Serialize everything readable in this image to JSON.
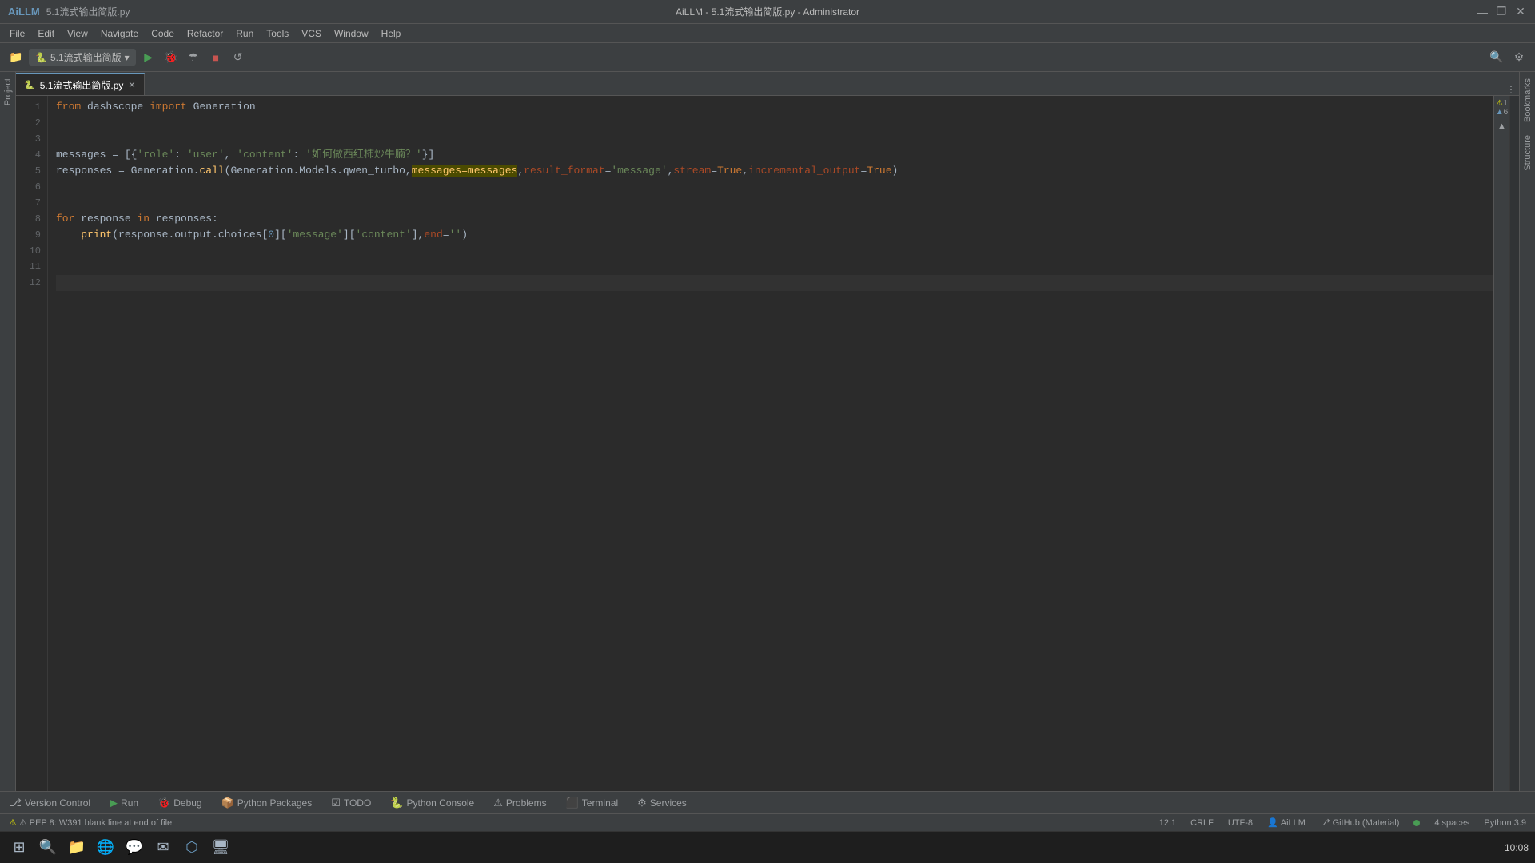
{
  "titleBar": {
    "appName": "AiLLM",
    "filePath": "5.1流式输出简版.py",
    "title": "AiLLM - 5.1流式输出简版.py - Administrator",
    "minimize": "—",
    "restore": "❐",
    "close": "✕"
  },
  "menuBar": {
    "items": [
      "File",
      "Edit",
      "View",
      "Navigate",
      "Code",
      "Refactor",
      "Run",
      "Tools",
      "VCS",
      "Window",
      "Help"
    ]
  },
  "toolbar": {
    "runConfig": "5.1流式输出简版",
    "runConfigDropdown": "▾"
  },
  "tabs": [
    {
      "label": "5.1流式输出简版.py",
      "active": true,
      "icon": "🐍"
    }
  ],
  "codeLines": [
    {
      "num": 1,
      "content": "from dashscope import Generation",
      "tokens": [
        {
          "t": "kw",
          "v": "from"
        },
        {
          "t": "var",
          "v": " dashscope "
        },
        {
          "t": "kw",
          "v": "import"
        },
        {
          "t": "var",
          "v": " Generation"
        }
      ]
    },
    {
      "num": 2,
      "content": "",
      "tokens": []
    },
    {
      "num": 3,
      "content": "",
      "tokens": []
    },
    {
      "num": 4,
      "content": "messages = [{'role': 'user', 'content': '如何做西红柿炒牛腩？'}]",
      "tokens": [
        {
          "t": "var",
          "v": "messages"
        },
        {
          "t": "var",
          "v": " = [{"
        },
        {
          "t": "str",
          "v": "'role'"
        },
        {
          "t": "var",
          "v": ": "
        },
        {
          "t": "str",
          "v": "'user'"
        },
        {
          "t": "var",
          "v": ", "
        },
        {
          "t": "str",
          "v": "'content'"
        },
        {
          "t": "var",
          "v": ": "
        },
        {
          "t": "str",
          "v": "'如何做西红柿炒牛腩？'"
        },
        {
          "t": "var",
          "v": "}]"
        }
      ]
    },
    {
      "num": 5,
      "content": "responses = Generation.call(Generation.Models.qwen_turbo,messages=messages,result_format='message',stream=True,incremental_output=True)",
      "tokens": [
        {
          "t": "var",
          "v": "responses"
        },
        {
          "t": "var",
          "v": " = "
        },
        {
          "t": "var",
          "v": "Generation"
        },
        {
          "t": "dot",
          "v": "."
        },
        {
          "t": "fn",
          "v": "call"
        },
        {
          "t": "var",
          "v": "("
        },
        {
          "t": "var",
          "v": "Generation"
        },
        {
          "t": "dot",
          "v": "."
        },
        {
          "t": "var",
          "v": "Models"
        },
        {
          "t": "dot",
          "v": "."
        },
        {
          "t": "var",
          "v": "qwen_turbo"
        },
        {
          "t": "var",
          "v": ","
        },
        {
          "t": "hl",
          "v": "messages=messages"
        },
        {
          "t": "var",
          "v": ","
        },
        {
          "t": "param-name",
          "v": "result_format"
        },
        {
          "t": "var",
          "v": "="
        },
        {
          "t": "str",
          "v": "'message'"
        },
        {
          "t": "var",
          "v": ","
        },
        {
          "t": "param-name",
          "v": "stream"
        },
        {
          "t": "var",
          "v": "="
        },
        {
          "t": "kw2",
          "v": "True"
        },
        {
          "t": "var",
          "v": ","
        },
        {
          "t": "param-name",
          "v": "incremental_output"
        },
        {
          "t": "var",
          "v": "="
        },
        {
          "t": "kw2",
          "v": "True"
        },
        {
          "t": "var",
          "v": ")"
        }
      ]
    },
    {
      "num": 6,
      "content": "",
      "tokens": []
    },
    {
      "num": 7,
      "content": "",
      "tokens": []
    },
    {
      "num": 8,
      "content": "for response in responses:",
      "tokens": [
        {
          "t": "kw",
          "v": "for"
        },
        {
          "t": "var",
          "v": " response "
        },
        {
          "t": "kw",
          "v": "in"
        },
        {
          "t": "var",
          "v": " responses:"
        }
      ]
    },
    {
      "num": 9,
      "content": "    print(response.output.choices[0]['message']['content'],end='')",
      "tokens": [
        {
          "t": "var",
          "v": "    "
        },
        {
          "t": "fn",
          "v": "print"
        },
        {
          "t": "var",
          "v": "(response"
        },
        {
          "t": "dot",
          "v": "."
        },
        {
          "t": "var",
          "v": "output"
        },
        {
          "t": "dot",
          "v": "."
        },
        {
          "t": "var",
          "v": "choices["
        },
        {
          "t": "num",
          "v": "0"
        },
        {
          "t": "var",
          "v": "]["
        },
        {
          "t": "str",
          "v": "'message'"
        },
        {
          "t": "var",
          "v": "]["
        },
        {
          "t": "str",
          "v": "'content'"
        },
        {
          "t": "var",
          "v": "],"
        },
        {
          "t": "param-name",
          "v": "end"
        },
        {
          "t": "var",
          "v": "="
        },
        {
          "t": "str",
          "v": "''"
        },
        {
          "t": "var",
          "v": ")"
        }
      ]
    },
    {
      "num": 10,
      "content": "",
      "tokens": []
    },
    {
      "num": 11,
      "content": "",
      "tokens": []
    },
    {
      "num": 12,
      "content": "",
      "tokens": [],
      "active": true
    }
  ],
  "bottomTools": [
    {
      "icon": "⎇",
      "label": "Version Control"
    },
    {
      "icon": "▶",
      "label": "Run"
    },
    {
      "icon": "🐞",
      "label": "Debug"
    },
    {
      "icon": "📦",
      "label": "Python Packages"
    },
    {
      "icon": "☑",
      "label": "TODO"
    },
    {
      "icon": "🐍",
      "label": "Python Console"
    },
    {
      "icon": "⚠",
      "label": "Problems"
    },
    {
      "icon": "⬛",
      "label": "Terminal"
    },
    {
      "icon": "⚙",
      "label": "Services"
    }
  ],
  "statusBar": {
    "warning": "⚠ PEP 8: W391 blank line at end of file",
    "position": "12:1",
    "lineEnding": "CRLF",
    "encoding": "UTF-8",
    "profile": "AiLLM",
    "vcs": "GitHub (Material)",
    "indent": "4 spaces",
    "python": "Python 3.9"
  },
  "taskbar": {
    "time": "10:08",
    "icons": [
      "⊞",
      "🔍",
      "📁",
      "🌐",
      "💬",
      "📧",
      "📝",
      "🖥"
    ]
  },
  "lineWarnings": {
    "1": "1",
    "6": "6"
  }
}
